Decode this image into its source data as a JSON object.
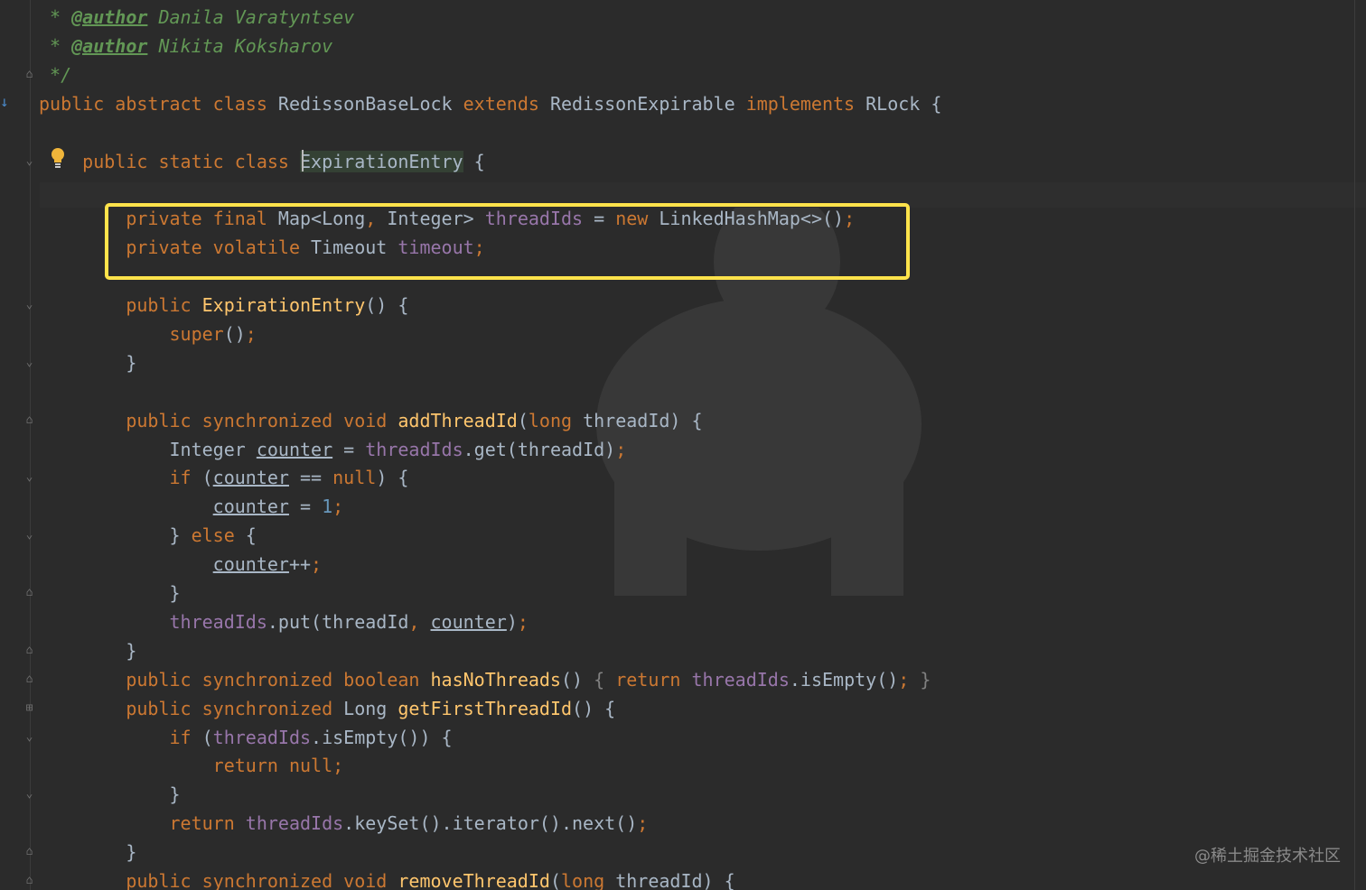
{
  "editor": {
    "lines": [
      [
        {
          "t": " * ",
          "c": "doc"
        },
        {
          "t": "@author",
          "c": "tag"
        },
        {
          "t": " Danila Varatyntsev",
          "c": "doc"
        }
      ],
      [
        {
          "t": " * ",
          "c": "doc"
        },
        {
          "t": "@author",
          "c": "tag"
        },
        {
          "t": " Nikita Koksharov",
          "c": "doc"
        }
      ],
      [
        {
          "t": " */",
          "c": "doc"
        }
      ],
      [
        {
          "t": "public abstract class ",
          "c": "kw"
        },
        {
          "t": "RedissonBaseLock ",
          "c": ""
        },
        {
          "t": "extends ",
          "c": "kw"
        },
        {
          "t": "RedissonExpirable ",
          "c": ""
        },
        {
          "t": "implements ",
          "c": "kw"
        },
        {
          "t": "RLock {",
          "c": ""
        }
      ],
      [],
      [
        {
          "t": "    public static class ",
          "c": "kw"
        },
        {
          "t": "ExpirationEntry",
          "c": "hl-ident"
        },
        {
          "t": " {",
          "c": ""
        }
      ],
      [],
      [
        {
          "t": "        private final ",
          "c": "kw"
        },
        {
          "t": "Map<Long",
          "c": ""
        },
        {
          "t": ", ",
          "c": "kw"
        },
        {
          "t": "Integer> ",
          "c": ""
        },
        {
          "t": "threadIds",
          "c": "fld"
        },
        {
          "t": " = ",
          "c": ""
        },
        {
          "t": "new ",
          "c": "kw"
        },
        {
          "t": "LinkedHashMap<>()",
          "c": ""
        },
        {
          "t": ";",
          "c": "kw"
        }
      ],
      [
        {
          "t": "        private volatile ",
          "c": "kw"
        },
        {
          "t": "Timeout ",
          "c": ""
        },
        {
          "t": "timeout",
          "c": "fld"
        },
        {
          "t": ";",
          "c": "kw"
        }
      ],
      [],
      [
        {
          "t": "        public ",
          "c": "kw"
        },
        {
          "t": "ExpirationEntry",
          "c": "fn"
        },
        {
          "t": "() {",
          "c": ""
        }
      ],
      [
        {
          "t": "            super",
          "c": "kw"
        },
        {
          "t": "()",
          "c": ""
        },
        {
          "t": ";",
          "c": "kw"
        }
      ],
      [
        {
          "t": "        }",
          "c": ""
        }
      ],
      [],
      [
        {
          "t": "        public synchronized void ",
          "c": "kw"
        },
        {
          "t": "addThreadId",
          "c": "fn"
        },
        {
          "t": "(",
          "c": ""
        },
        {
          "t": "long ",
          "c": "kw"
        },
        {
          "t": "threadId) {",
          "c": ""
        }
      ],
      [
        {
          "t": "            Integer ",
          "c": ""
        },
        {
          "t": "counter",
          "c": "ul"
        },
        {
          "t": " = ",
          "c": ""
        },
        {
          "t": "threadIds",
          "c": "fld"
        },
        {
          "t": ".get(threadId)",
          "c": ""
        },
        {
          "t": ";",
          "c": "kw"
        }
      ],
      [
        {
          "t": "            if ",
          "c": "kw"
        },
        {
          "t": "(",
          "c": ""
        },
        {
          "t": "counter",
          "c": "ul"
        },
        {
          "t": " == ",
          "c": ""
        },
        {
          "t": "null",
          "c": "kw"
        },
        {
          "t": ") {",
          "c": ""
        }
      ],
      [
        {
          "t": "                ",
          "c": ""
        },
        {
          "t": "counter",
          "c": "ul"
        },
        {
          "t": " = ",
          "c": ""
        },
        {
          "t": "1",
          "c": "num"
        },
        {
          "t": ";",
          "c": "kw"
        }
      ],
      [
        {
          "t": "            } ",
          "c": ""
        },
        {
          "t": "else ",
          "c": "kw"
        },
        {
          "t": "{",
          "c": ""
        }
      ],
      [
        {
          "t": "                ",
          "c": ""
        },
        {
          "t": "counter",
          "c": "ul"
        },
        {
          "t": "++",
          "c": ""
        },
        {
          "t": ";",
          "c": "kw"
        }
      ],
      [
        {
          "t": "            }",
          "c": ""
        }
      ],
      [
        {
          "t": "            ",
          "c": ""
        },
        {
          "t": "threadIds",
          "c": "fld"
        },
        {
          "t": ".put(threadId",
          "c": ""
        },
        {
          "t": ", ",
          "c": "kw"
        },
        {
          "t": "counter",
          "c": "ul"
        },
        {
          "t": ")",
          "c": ""
        },
        {
          "t": ";",
          "c": "kw"
        }
      ],
      [
        {
          "t": "        }",
          "c": ""
        }
      ],
      [
        {
          "t": "        public synchronized boolean ",
          "c": "kw"
        },
        {
          "t": "hasNoThreads",
          "c": "fn"
        },
        {
          "t": "() ",
          "c": ""
        },
        {
          "t": "{ ",
          "c": "dim"
        },
        {
          "t": "return ",
          "c": "kw"
        },
        {
          "t": "threadIds",
          "c": "fld"
        },
        {
          "t": ".isEmpty()",
          "c": ""
        },
        {
          "t": "; ",
          "c": "kw"
        },
        {
          "t": "}",
          "c": "dim"
        }
      ],
      [
        {
          "t": "        public synchronized ",
          "c": "kw"
        },
        {
          "t": "Long ",
          "c": ""
        },
        {
          "t": "getFirstThreadId",
          "c": "fn"
        },
        {
          "t": "() {",
          "c": ""
        }
      ],
      [
        {
          "t": "            if ",
          "c": "kw"
        },
        {
          "t": "(",
          "c": ""
        },
        {
          "t": "threadIds",
          "c": "fld"
        },
        {
          "t": ".isEmpty()) {",
          "c": ""
        }
      ],
      [
        {
          "t": "                return null",
          "c": "kw"
        },
        {
          "t": ";",
          "c": "kw"
        }
      ],
      [
        {
          "t": "            }",
          "c": ""
        }
      ],
      [
        {
          "t": "            return ",
          "c": "kw"
        },
        {
          "t": "threadIds",
          "c": "fld"
        },
        {
          "t": ".keySet().iterator().next()",
          "c": ""
        },
        {
          "t": ";",
          "c": "kw"
        }
      ],
      [
        {
          "t": "        }",
          "c": ""
        }
      ],
      [
        {
          "t": "        public synchronized void ",
          "c": "kw"
        },
        {
          "t": "removeThreadId",
          "c": "fn"
        },
        {
          "t": "(",
          "c": ""
        },
        {
          "t": "long ",
          "c": "kw"
        },
        {
          "t": "threadId) {",
          "c": ""
        }
      ]
    ],
    "fold_marks": [
      "⌂",
      "⌄",
      "⌄",
      "⌄",
      "⌂",
      "⌄",
      "⌄",
      "⌂",
      "⌂",
      "⌂",
      "⊞",
      "⌄",
      "⌄",
      "⌂",
      "⌂",
      "⌄"
    ]
  },
  "watermark": "@稀土掘金技术社区",
  "icons": {
    "bulb": "lightbulb-icon",
    "gutter_arrow": "override-arrow-icon"
  },
  "colors": {
    "background": "#2b2b2b",
    "keyword": "#cc7832",
    "field": "#9876aa",
    "function": "#ffc66d",
    "number": "#6897bb",
    "doc": "#629755",
    "highlight_box": "#ffe34b"
  }
}
